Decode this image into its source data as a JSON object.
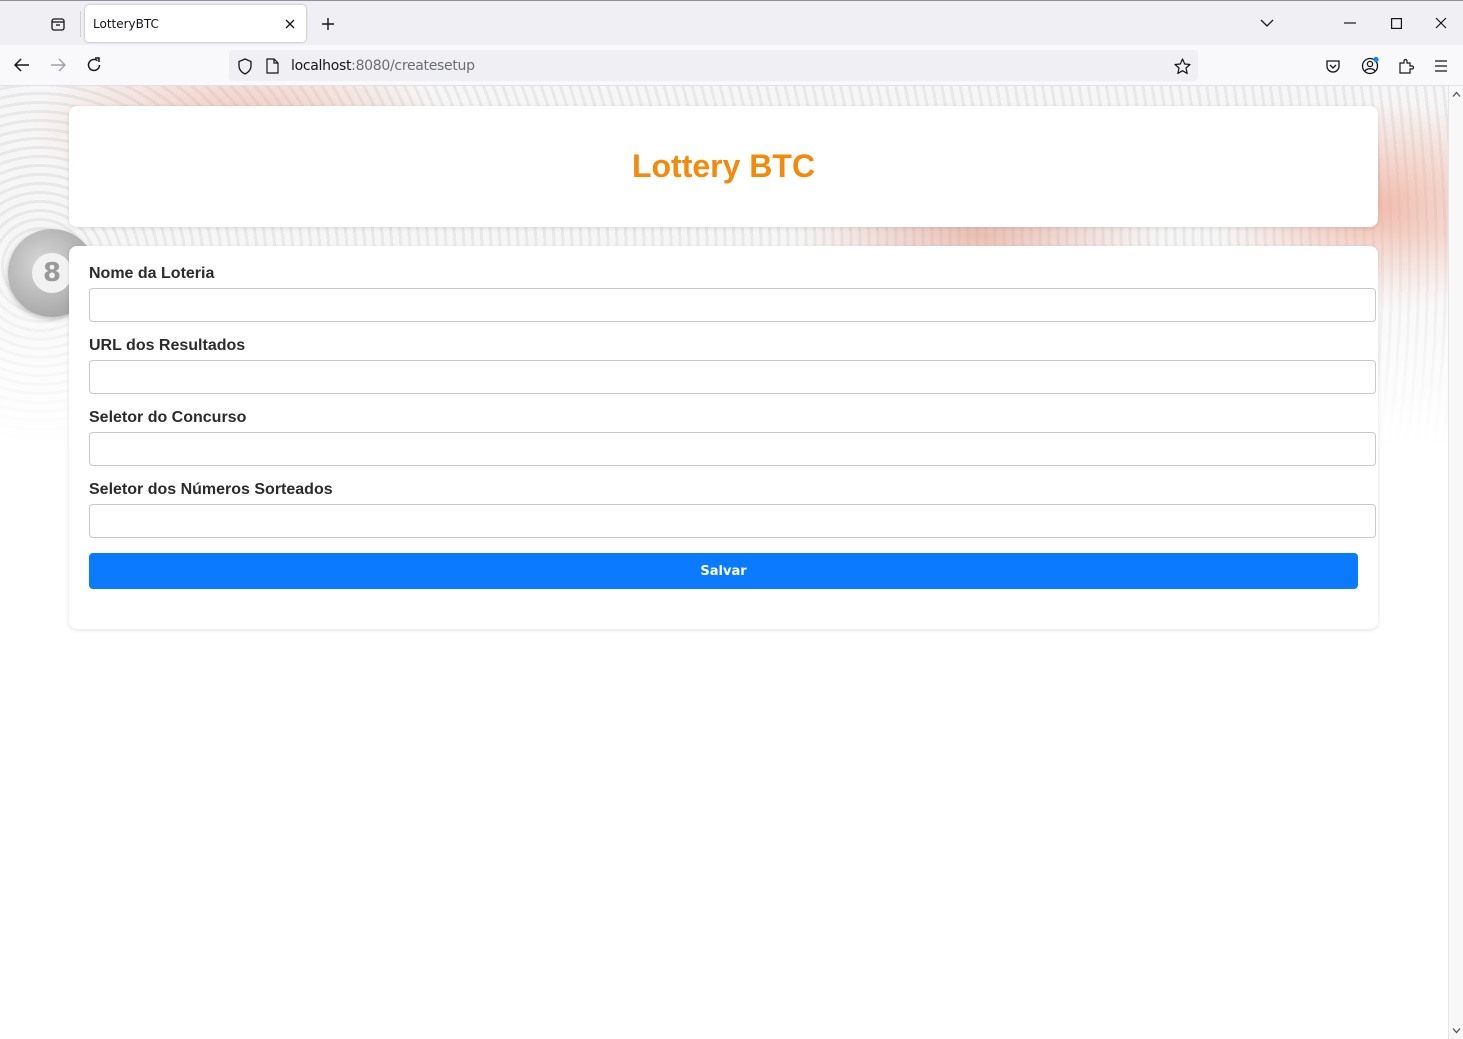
{
  "browser": {
    "tab_title": "LotteryBTC",
    "url_host": "localhost",
    "url_path": ":8080/createsetup",
    "icons": {
      "tab_list": "tab-list-icon",
      "tab_close": "close-icon",
      "new_tab": "plus-icon",
      "list_all_tabs": "chevron-down-icon",
      "minimize": "minimize-icon",
      "maximize": "maximize-icon",
      "close_window": "close-icon",
      "back": "arrow-left-icon",
      "forward": "arrow-right-icon",
      "reload": "reload-icon",
      "tracking": "shield-icon",
      "page_info": "page-icon",
      "bookmark": "star-icon",
      "pocket": "pocket-icon",
      "account": "account-icon",
      "extensions": "puzzle-icon",
      "menu": "hamburger-menu-icon"
    }
  },
  "page": {
    "header_title": "Lottery BTC",
    "accent_color": "#f28a0c",
    "button_color": "#0a7bff",
    "form": {
      "fields": [
        {
          "label": "Nome da Loteria",
          "value": ""
        },
        {
          "label": "URL dos Resultados",
          "value": ""
        },
        {
          "label": "Seletor do Concurso",
          "value": ""
        },
        {
          "label": "Seletor dos Números Sorteados",
          "value": ""
        }
      ],
      "submit_label": "Salvar"
    },
    "background_ball_number": "8"
  }
}
